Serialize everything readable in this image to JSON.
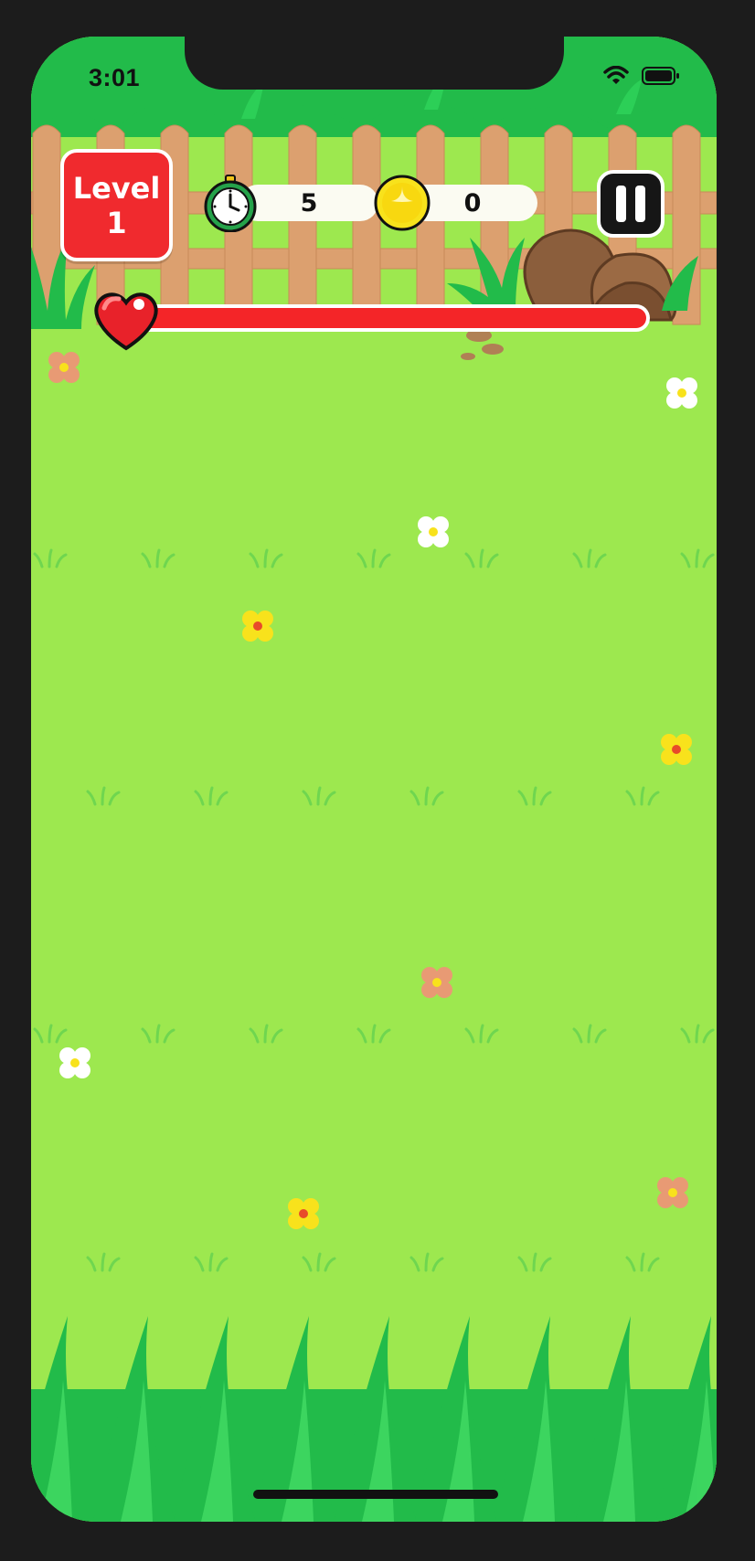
{
  "status_bar": {
    "time": "3:01",
    "icons": [
      "wifi-icon",
      "battery-icon"
    ]
  },
  "hud": {
    "level_label": "Level",
    "level_number": "1",
    "timer_value": "5",
    "timer_icon": "stopwatch-icon",
    "coin_value": "0",
    "coin_icon": "coin-icon",
    "pause_icon": "pause-icon",
    "health_icon": "heart-icon",
    "health_fraction": 1.0
  },
  "colors": {
    "grass": "#9de84f",
    "dark_grass": "#22bb4a",
    "fence": "#dca06f",
    "level_badge": "#f02a2e",
    "health_bar": "#f42528",
    "coin": "#f8e21c"
  }
}
